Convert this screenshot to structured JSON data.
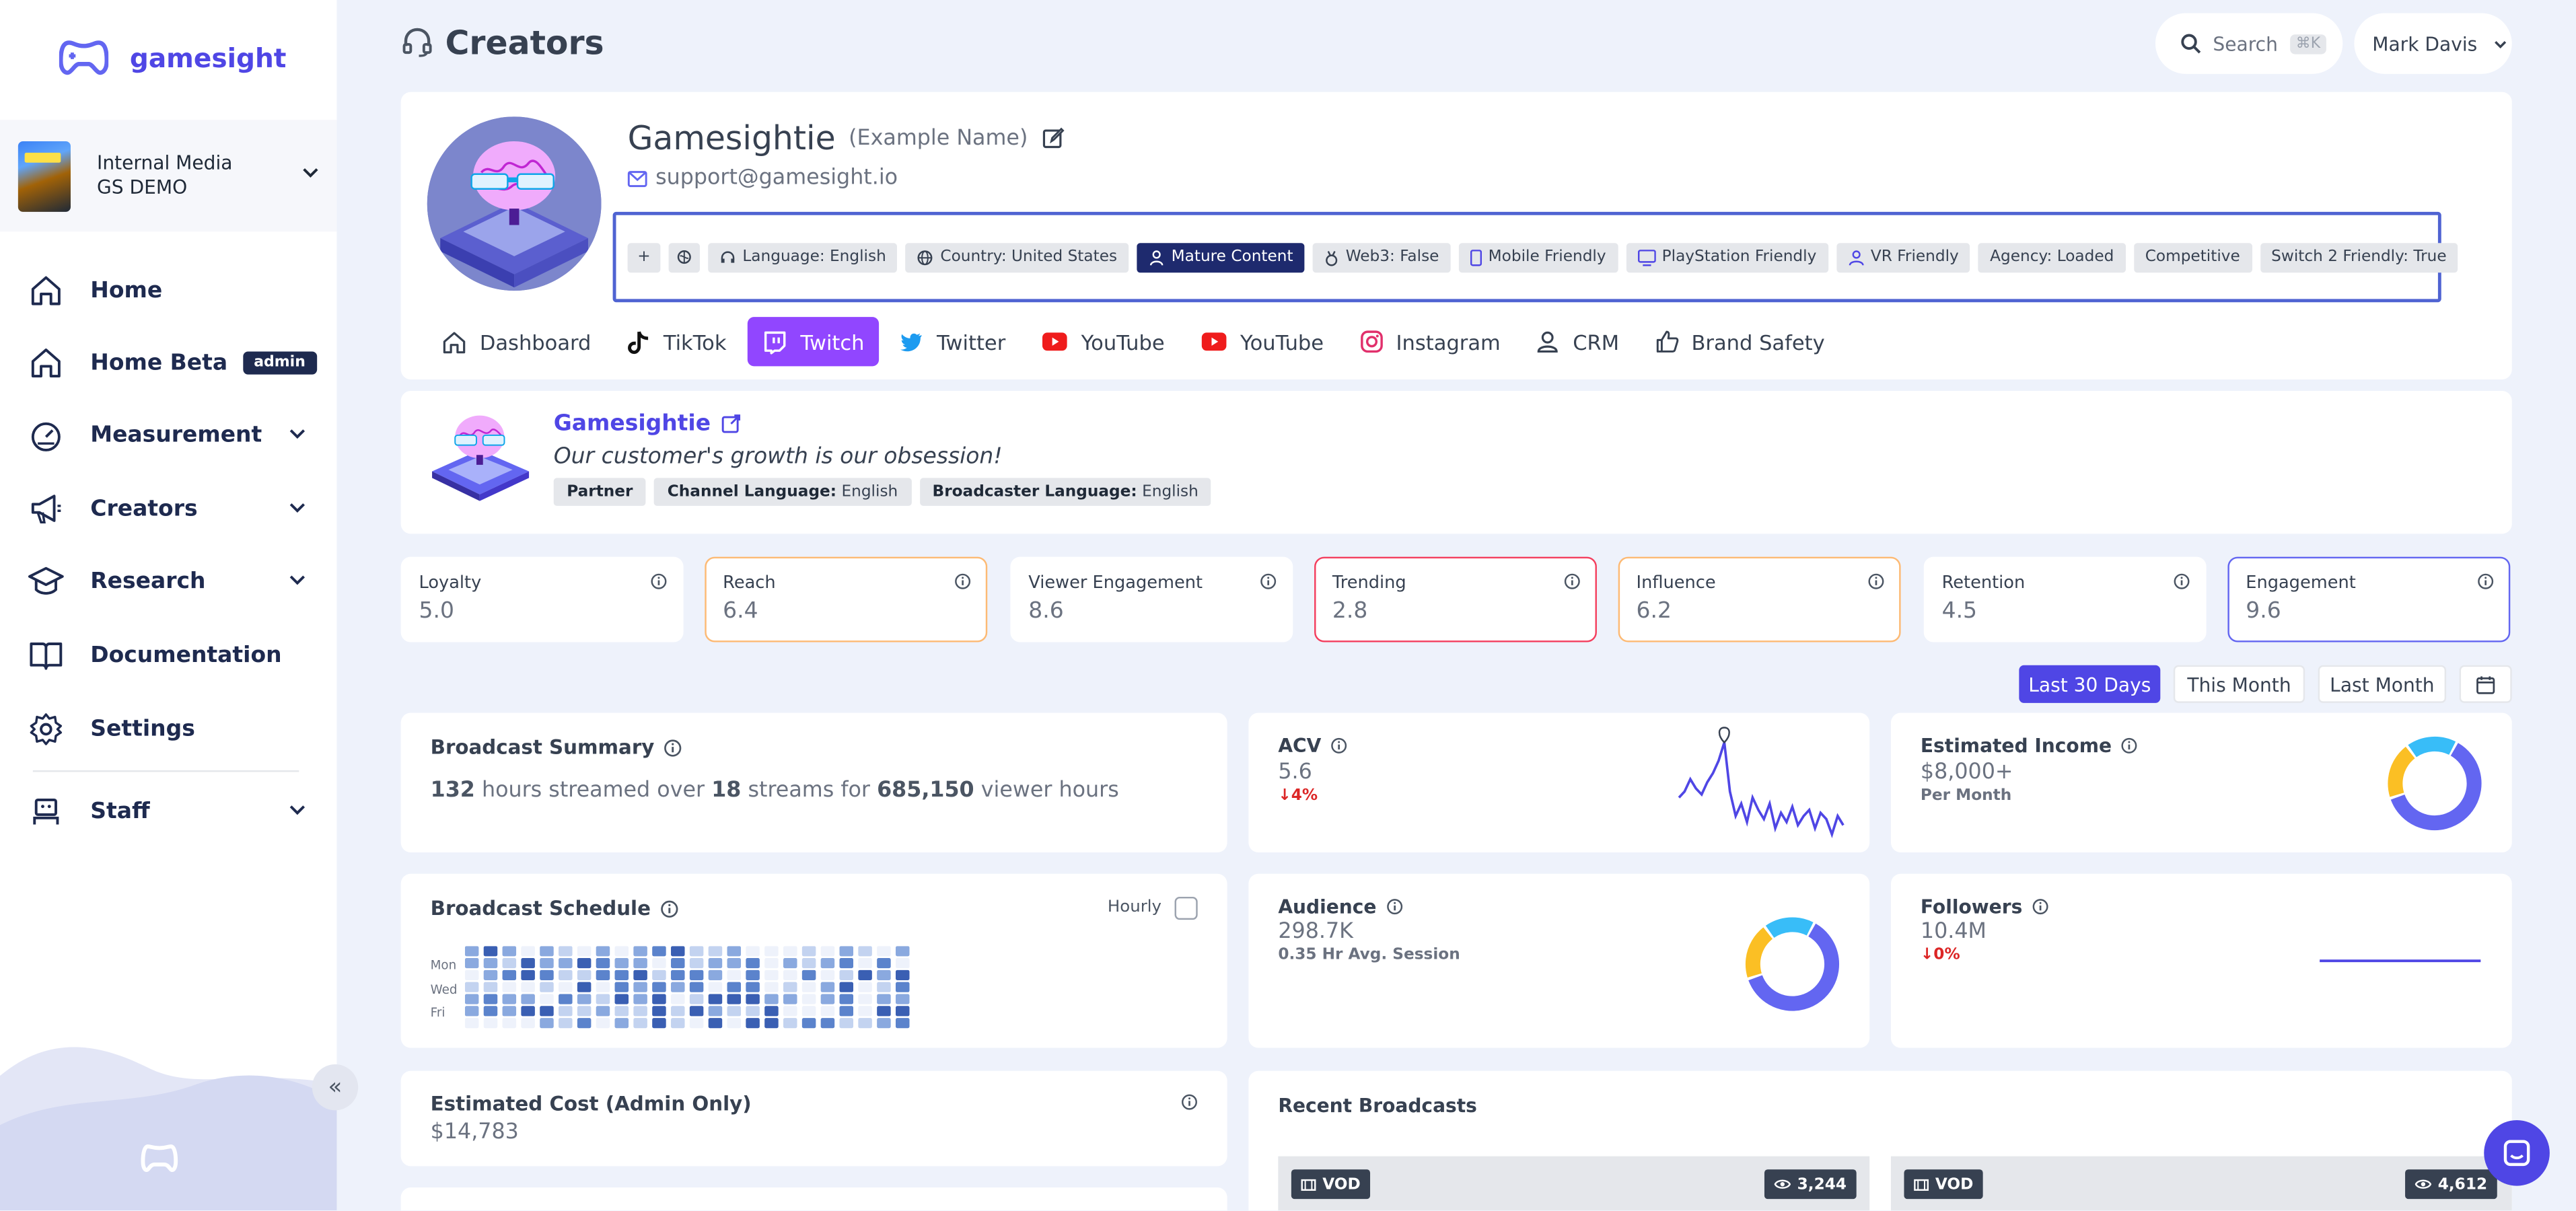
{
  "sidebar": {
    "brand": "gamesight",
    "org": {
      "line1": "Internal Media",
      "line2": "GS DEMO"
    },
    "items": [
      {
        "label": "Home",
        "icon": "home-icon"
      },
      {
        "label": "Home Beta",
        "icon": "home-icon",
        "badge": "admin"
      },
      {
        "label": "Measurement",
        "icon": "gauge-icon"
      },
      {
        "label": "Creators",
        "icon": "megaphone-icon"
      },
      {
        "label": "Research",
        "icon": "graduation-cap-icon"
      },
      {
        "label": "Documentation",
        "icon": "book-icon"
      },
      {
        "label": "Settings",
        "icon": "gear-icon"
      },
      {
        "label": "Staff",
        "icon": "robot-icon"
      }
    ]
  },
  "header": {
    "title": "Creators",
    "search_label": "Search",
    "search_shortcut": "⌘K",
    "user_name": "Mark Davis"
  },
  "profile": {
    "name": "Gamesightie",
    "example": "(Example Name)",
    "email": "support@gamesight.io",
    "tags": [
      {
        "label": "Language: English",
        "icon": "headset-icon"
      },
      {
        "label": "Country: United States",
        "icon": "globe-icon"
      },
      {
        "label": "Mature Content",
        "icon": "person-icon",
        "dark": true
      },
      {
        "label": "Web3: False",
        "icon": "medal-icon"
      },
      {
        "label": "Mobile Friendly",
        "icon": "mobile-icon"
      },
      {
        "label": "PlayStation Friendly",
        "icon": "monitor-icon"
      },
      {
        "label": "VR Friendly",
        "icon": "vr-icon"
      },
      {
        "label": "Agency: Loaded"
      },
      {
        "label": "Competitive"
      },
      {
        "label": "Switch 2 Friendly: True"
      }
    ],
    "tabs": [
      {
        "label": "Dashboard",
        "icon": "home-icon"
      },
      {
        "label": "TikTok",
        "icon": "tiktok-icon"
      },
      {
        "label": "Twitch",
        "icon": "twitch-icon",
        "active": true
      },
      {
        "label": "Twitter",
        "icon": "twitter-icon"
      },
      {
        "label": "YouTube",
        "icon": "youtube-icon"
      },
      {
        "label": "YouTube",
        "icon": "youtube-icon"
      },
      {
        "label": "Instagram",
        "icon": "instagram-icon"
      },
      {
        "label": "CRM",
        "icon": "user-icon"
      },
      {
        "label": "Brand Safety",
        "icon": "thumbs-up-icon"
      }
    ]
  },
  "channel": {
    "name": "Gamesightie",
    "description": "Our customer's growth is our obsession!",
    "partner": "Partner",
    "channel_language_label": "Channel Language:",
    "channel_language": "English",
    "broadcaster_language_label": "Broadcaster Language:",
    "broadcaster_language": "English"
  },
  "scores": [
    {
      "label": "Loyalty",
      "value": "5.0",
      "border": "#ffffff"
    },
    {
      "label": "Reach",
      "value": "6.4",
      "border": "#fdba74"
    },
    {
      "label": "Viewer Engagement",
      "value": "8.6",
      "border": "#ffffff"
    },
    {
      "label": "Trending",
      "value": "2.8",
      "border": "#f43f5e"
    },
    {
      "label": "Influence",
      "value": "6.2",
      "border": "#fdba74"
    },
    {
      "label": "Retention",
      "value": "4.5",
      "border": "#ffffff"
    },
    {
      "label": "Engagement",
      "value": "9.6",
      "border": "#6366f1"
    }
  ],
  "date_range": {
    "last30": "Last 30 Days",
    "this_month": "This Month",
    "last_month": "Last Month"
  },
  "broadcast_summary": {
    "title": "Broadcast Summary",
    "hours": "132",
    "t1": "hours streamed over",
    "streams": "18",
    "t2": "streams for",
    "viewer_hours": "685,150",
    "t3": "viewer hours"
  },
  "acv": {
    "title": "ACV",
    "value": "5.6",
    "delta": "↓4%",
    "spark": [
      24,
      22,
      18,
      21,
      23,
      19,
      16,
      12,
      6,
      22,
      30,
      26,
      32,
      24,
      28,
      31,
      26,
      34,
      29,
      32,
      27,
      33,
      30,
      28,
      34,
      29,
      31,
      36,
      30,
      33
    ]
  },
  "estimated_income": {
    "title": "Estimated Income",
    "value": "$8,000+",
    "sub": "Per Month",
    "ring": [
      {
        "value": 0.62,
        "color": "#6366f1"
      },
      {
        "value": 0.2,
        "color": "#fbbf24"
      },
      {
        "value": 0.18,
        "color": "#38bdf8"
      }
    ]
  },
  "broadcast_schedule": {
    "title": "Broadcast Schedule",
    "hourly": "Hourly",
    "days": [
      "Mon",
      "Wed",
      "Fri"
    ]
  },
  "audience": {
    "title": "Audience",
    "value": "298.7K",
    "sub": "0.35 Hr Avg. Session",
    "ring": [
      {
        "value": 0.62,
        "color": "#6366f1"
      },
      {
        "value": 0.2,
        "color": "#fbbf24"
      },
      {
        "value": 0.18,
        "color": "#38bdf8"
      }
    ]
  },
  "followers": {
    "title": "Followers",
    "value": "10.4M",
    "delta": "↓0%"
  },
  "estimated_cost": {
    "title": "Estimated Cost (Admin Only)",
    "value": "$14,783"
  },
  "recent_broadcasts": {
    "title": "Recent Broadcasts",
    "items": [
      {
        "type": "VOD",
        "views": "3,244"
      },
      {
        "type": "VOD",
        "views": "4,612"
      }
    ]
  },
  "colors": {
    "accent": "#4f46e5",
    "twitch": "#9146ff",
    "navy": "#1e2a6e"
  }
}
